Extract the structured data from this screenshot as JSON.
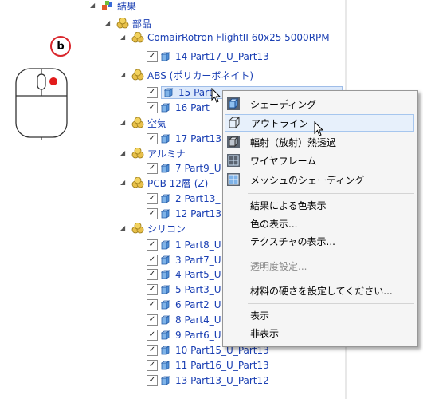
{
  "tree": {
    "root_label": "結果",
    "parts_label": "部品",
    "groups": [
      {
        "name": "ComairRotron FlightII  60x25 5000RPM",
        "items": [
          "14 Part17_U_Part13"
        ]
      },
      {
        "name": "ABS (ポリカーボネイト)",
        "items": [
          "15 Part",
          "16 Part"
        ]
      },
      {
        "name": "空気",
        "items": [
          "17 Part13"
        ]
      },
      {
        "name": "アルミナ",
        "items": [
          "7 Part9_U"
        ]
      },
      {
        "name": "PCB 12層 (Z)",
        "items": [
          "2 Part13_",
          "12 Part13"
        ]
      },
      {
        "name": "シリコン",
        "items": [
          "1 Part8_U",
          "3 Part7_U",
          "4 Part5_U",
          "5 Part3_U",
          "6 Part2_U",
          "8 Part4_U",
          "9 Part6_U",
          "10 Part15_U_Part13",
          "11 Part16_U_Part13",
          "13 Part13_U_Part12"
        ]
      }
    ]
  },
  "mouse_badge": "b",
  "context_menu": {
    "items": [
      {
        "label": "シェーディング",
        "icon": "shaded-cube-icon"
      },
      {
        "label": "アウトライン",
        "icon": "outline-cube-icon"
      },
      {
        "label": "輻射（放射）熱透過",
        "icon": "radiation-cube-icon"
      },
      {
        "label": "ワイヤフレーム",
        "icon": "wireframe-icon"
      },
      {
        "label": "メッシュのシェーディング",
        "icon": "mesh-shading-icon"
      },
      {
        "label": "結果による色表示"
      },
      {
        "label": "色の表示..."
      },
      {
        "label": "テクスチャの表示..."
      },
      {
        "label": "透明度設定..."
      },
      {
        "label": "材料の硬さを設定してください..."
      },
      {
        "label": "表示"
      },
      {
        "label": "非表示"
      }
    ]
  },
  "colors": {
    "tree_text": "#1a3fb3",
    "highlight": "#dce9fb",
    "badge_red": "#d9262c"
  }
}
